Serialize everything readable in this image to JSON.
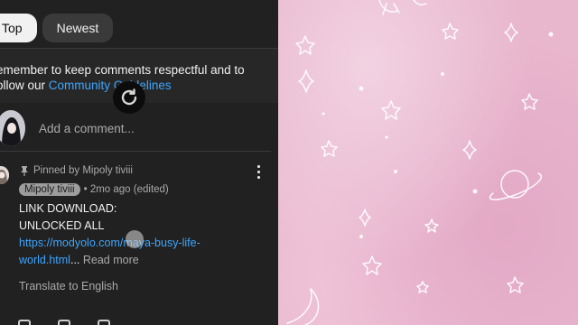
{
  "filters": {
    "top": "Top",
    "newest": "Newest"
  },
  "notice": {
    "text": "emember to keep comments respectful and to ollow our ",
    "link": "Community Guidelines"
  },
  "add_comment": {
    "placeholder": "Add a comment..."
  },
  "comment": {
    "pinned_by": "Pinned by Mipoly tiviii",
    "author": "Mipoly tiviii",
    "time": "• 2mo ago (edited)",
    "line1": "LINK DOWNLOAD:",
    "line2": "UNLOCKED ALL",
    "link": "https://modyolo.com/maya-busy-life-world.html",
    "ellipsis": "...",
    "read_more": "Read more",
    "translate": "Translate to English"
  },
  "icons": [
    "pin-icon",
    "more-icon",
    "spinner-icon",
    "like-icon",
    "dislike-icon",
    "reply-icon"
  ],
  "colors": {
    "link": "#3ea6ff",
    "panel": "#212121",
    "background": "#e8b6cd"
  }
}
